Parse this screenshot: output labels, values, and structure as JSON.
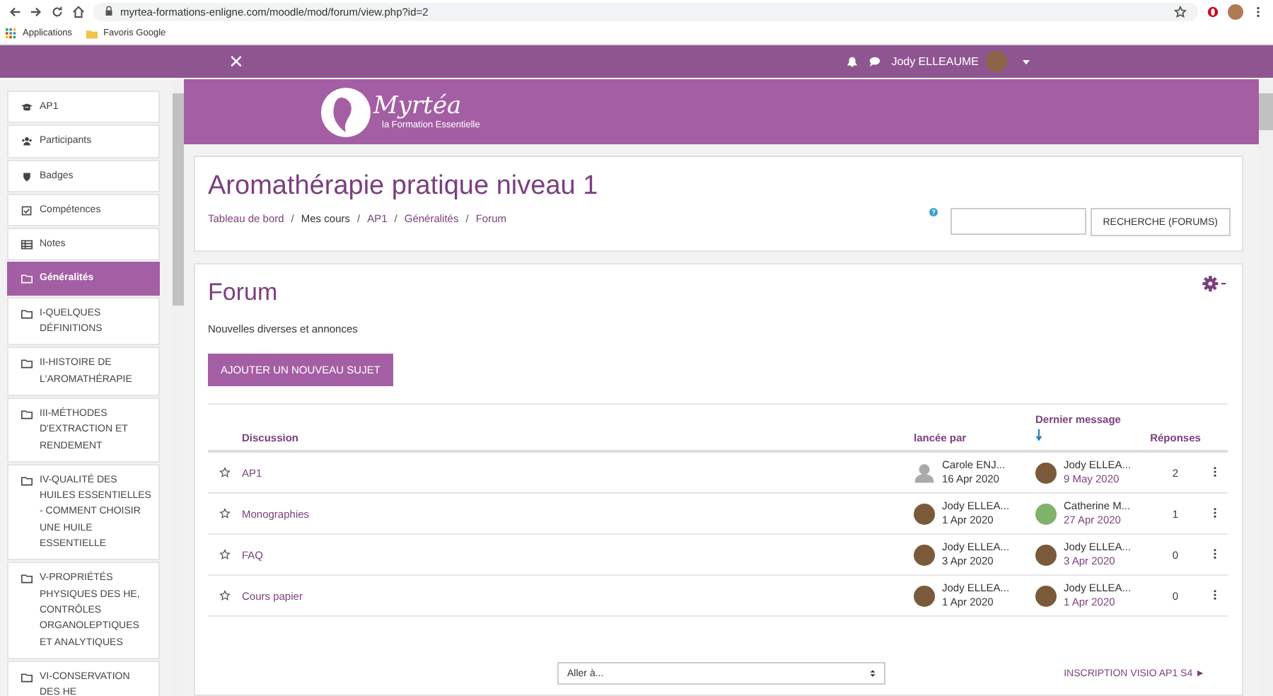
{
  "browser": {
    "url": "myrtea-formations-enligne.com/moodle/mod/forum/view.php?id=2",
    "bookmarks": [
      "Applications",
      "Favoris Google"
    ]
  },
  "navbar": {
    "close": "×",
    "user": "Jody ELLEAUME"
  },
  "sidebar": {
    "items": [
      {
        "label": "AP1",
        "kind": "cap",
        "selected": false
      },
      {
        "label": "Participants",
        "kind": "users",
        "selected": false
      },
      {
        "label": "Badges",
        "kind": "shield",
        "selected": false
      },
      {
        "label": "Compétences",
        "kind": "check",
        "selected": false
      },
      {
        "label": "Notes",
        "kind": "table",
        "selected": false
      },
      {
        "label": "Généralités",
        "kind": "folder",
        "selected": true
      },
      {
        "label": "I-QUELQUES DÉFINITIONS",
        "kind": "folder",
        "selected": false
      },
      {
        "label": "II-HISTOIRE DE L'AROMATHÉRAPIE",
        "kind": "folder",
        "selected": false
      },
      {
        "label": "III-MÉTHODES D'EXTRACTION ET RENDEMENT",
        "kind": "folder",
        "selected": false
      },
      {
        "label": "IV-QUALITÉ DES HUILES ESSENTIELLES - COMMENT CHOISIR UNE HUILE ESSENTIELLE",
        "kind": "folder",
        "selected": false
      },
      {
        "label": "V-PROPRIÉTÉS PHYSIQUES DES HE, CONTRÔLES ORGANOLEPTIQUES ET ANALYTIQUES",
        "kind": "folder",
        "selected": false
      },
      {
        "label": "VI-CONSERVATION DES HE",
        "kind": "folder",
        "selected": false
      }
    ]
  },
  "banner": {
    "logo": "Myrtéa",
    "tagline": "la Formation Essentielle"
  },
  "course": {
    "title": "Aromathérapie pratique niveau 1",
    "breadcrumb": [
      "Tableau de bord",
      "Mes cours",
      "AP1",
      "Généralités",
      "Forum"
    ],
    "breadcrumb_separator": "/",
    "search_button": "RECHERCHE (FORUMS)"
  },
  "forum": {
    "title": "Forum",
    "description": "Nouvelles diverses et annonces",
    "add_button": "AJOUTER UN NOUVEAU SUJET",
    "columns": [
      "Discussion",
      "lancée par",
      "Dernier message",
      "Réponses"
    ],
    "rows": [
      {
        "discussion": "AP1",
        "started": {
          "kind": "generic",
          "name": "Carole ENJ...",
          "date": "16 Apr 2020"
        },
        "last": {
          "kind": "photo",
          "name": "Jody ELLEA...",
          "date": "9 May 2020"
        },
        "replies": "2"
      },
      {
        "discussion": "Monographies",
        "started": {
          "kind": "photo",
          "name": "Jody ELLEA...",
          "date": "1 Apr 2020"
        },
        "last": {
          "kind": "green",
          "name": "Catherine M...",
          "date": "27 Apr 2020"
        },
        "replies": "1"
      },
      {
        "discussion": "FAQ",
        "started": {
          "kind": "photo",
          "name": "Jody ELLEA...",
          "date": "3 Apr 2020"
        },
        "last": {
          "kind": "photo",
          "name": "Jody ELLEA...",
          "date": "3 Apr 2020"
        },
        "replies": "0"
      },
      {
        "discussion": "Cours papier",
        "started": {
          "kind": "photo",
          "name": "Jody ELLEA...",
          "date": "1 Apr 2020"
        },
        "last": {
          "kind": "photo",
          "name": "Jody ELLEA...",
          "date": "1 Apr 2020"
        },
        "replies": "0"
      }
    ],
    "jump_select": "Aller à...",
    "next_link": "INSCRIPTION VISIO AP1 S4 ►"
  }
}
